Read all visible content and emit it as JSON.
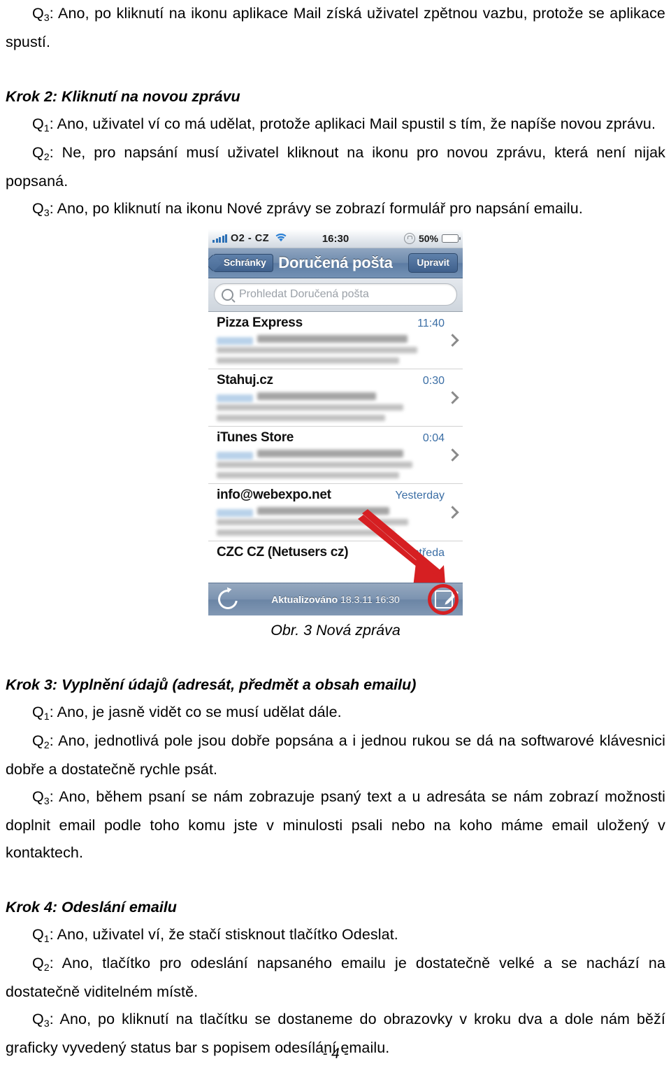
{
  "document": {
    "page_number_label": "- 4 -",
    "blocks": [
      {
        "type": "paragraph",
        "id": "p_q3_krok1",
        "text": "Q3: Ano, po kliknutí na ikonu aplikace Mail získá uživatel zpětnou vazbu, protože se aplikace spustí.",
        "q_label": "Q",
        "q_index": "3",
        "rest": ": Ano, po kliknutí na ikonu aplikace Mail získá uživatel zpětnou vazbu, protože se aplikace spustí."
      },
      {
        "type": "heading",
        "id": "h_krok2",
        "text": "Krok 2: Kliknutí na novou zprávu"
      },
      {
        "type": "paragraph",
        "id": "p_k2_q1",
        "q_label": "Q",
        "q_index": "1",
        "rest": ": Ano, uživatel ví co má udělat, protože aplikaci Mail spustil s tím, že napíše novou zprávu."
      },
      {
        "type": "paragraph",
        "id": "p_k2_q2",
        "q_label": "Q",
        "q_index": "2",
        "rest": ": Ne, pro napsání musí uživatel kliknout na ikonu pro novou zprávu, která není nijak popsaná."
      },
      {
        "type": "paragraph",
        "id": "p_k2_q3",
        "q_label": "Q",
        "q_index": "3",
        "rest": ": Ano, po kliknutí na ikonu Nové zprávy se zobrazí formulář pro napsání emailu."
      },
      {
        "type": "heading",
        "id": "h_krok3",
        "text": "Krok 3: Vyplnění údajů (adresát, předmět a obsah emailu)"
      },
      {
        "type": "paragraph",
        "id": "p_k3_q1",
        "q_label": "Q",
        "q_index": "1",
        "rest": ": Ano, je jasně vidět co se musí udělat dále."
      },
      {
        "type": "paragraph",
        "id": "p_k3_q2",
        "q_label": "Q",
        "q_index": "2",
        "rest": ": Ano, jednotlivá pole jsou dobře popsána a i jednou rukou se dá na softwarové klávesnici dobře a dostatečně rychle psát."
      },
      {
        "type": "paragraph",
        "id": "p_k3_q3",
        "q_label": "Q",
        "q_index": "3",
        "rest": ": Ano, během psaní se nám zobrazuje psaný text a u adresáta se nám zobrazí možnosti doplnit email podle toho komu jste v minulosti psali nebo na koho máme email uložený v kontaktech."
      },
      {
        "type": "heading",
        "id": "h_krok4",
        "text": "Krok 4: Odeslání emailu"
      },
      {
        "type": "paragraph",
        "id": "p_k4_q1",
        "q_label": "Q",
        "q_index": "1",
        "rest": ": Ano, uživatel ví, že stačí stisknout tlačítko Odeslat."
      },
      {
        "type": "paragraph",
        "id": "p_k4_q2",
        "q_label": "Q",
        "q_index": "2",
        "rest": ": Ano, tlačítko pro odeslání napsaného emailu je dostatečně velké a se nachází na dostatečně viditelném místě."
      },
      {
        "type": "paragraph",
        "id": "p_k4_q3",
        "q_label": "Q",
        "q_index": "3",
        "rest": ": Ano, po kliknutí na tlačítku se dostaneme do obrazovky v kroku dva a dole nám běží graficky vyvedený status bar s popisem odesílání emailu."
      }
    ]
  },
  "figure": {
    "caption": "Obr. 3 Nová zpráva",
    "annotation": {
      "arrow_color": "#d61f22",
      "highlight_color": "#d61f22",
      "points_to": "compose-new-message-button"
    },
    "phone": {
      "status_bar": {
        "carrier": "O2 - CZ",
        "time": "16:30",
        "battery_percent": "50%",
        "signal_icon": "signal-bars-icon",
        "wifi_icon": "wifi-icon",
        "rotation_lock_icon": "rotation-lock-icon",
        "battery_icon": "battery-icon"
      },
      "nav_bar": {
        "back_label": "Schránky",
        "title": "Doručená pošta",
        "edit_label": "Upravit"
      },
      "search": {
        "placeholder": "Prohledat Doručená pošta",
        "icon": "search-icon"
      },
      "mail_rows": [
        {
          "sender": "Pizza Express",
          "time": "11:40"
        },
        {
          "sender": "Stahuj.cz",
          "time": "0:30"
        },
        {
          "sender": "iTunes Store",
          "time": "0:04"
        },
        {
          "sender": "info@webexpo.net",
          "time": "Yesterday"
        },
        {
          "sender": "CZC CZ (Netusers cz)",
          "time": "středa"
        }
      ],
      "toolbar": {
        "refresh_icon": "refresh-icon",
        "status_label": "Aktualizováno",
        "status_datetime": "18.3.11  16:30",
        "compose_icon": "compose-icon"
      }
    }
  }
}
